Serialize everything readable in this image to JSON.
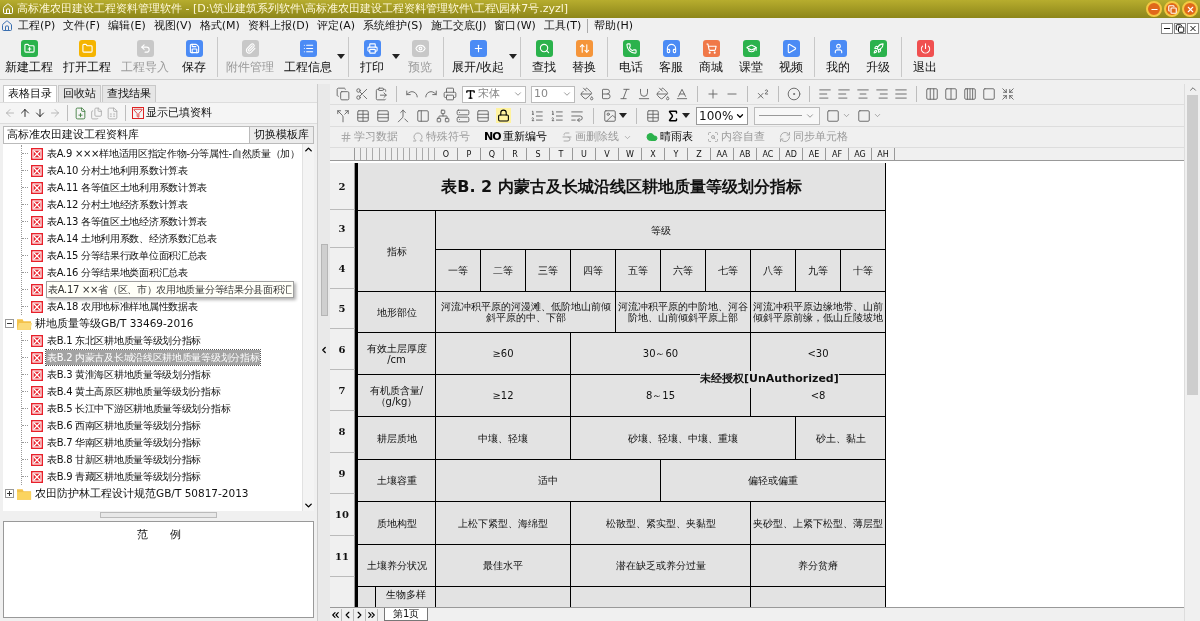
{
  "window": {
    "title": "高标准农田建设工程资料管理软件 - [D:\\筑业建筑系列软件\\高标准农田建设工程资料管理软件\\工程\\园林7号.zyzl]"
  },
  "menu": [
    "工程(P)",
    "文件(F)",
    "编辑(E)",
    "视图(V)",
    "格式(M)",
    "资料上报(D)",
    "评定(A)",
    "系统维护(S)",
    "施工交底(J)",
    "窗口(W)",
    "工具(T)",
    "帮助(H)"
  ],
  "toolbar": [
    [
      {
        "label": "新建工程",
        "disabled": false,
        "dropdown": false
      },
      {
        "label": "打开工程",
        "disabled": false,
        "dropdown": false
      },
      {
        "label": "工程导入",
        "disabled": true,
        "dropdown": false
      },
      {
        "label": "保存",
        "disabled": false,
        "dropdown": false
      }
    ],
    [
      {
        "label": "附件管理",
        "disabled": true,
        "dropdown": false
      },
      {
        "label": "工程信息",
        "disabled": false,
        "dropdown": true
      }
    ],
    [
      {
        "label": "打印",
        "disabled": false,
        "dropdown": true
      },
      {
        "label": "预览",
        "disabled": true,
        "dropdown": false
      }
    ],
    [
      {
        "label": "展开/收起",
        "disabled": false,
        "dropdown": true
      }
    ],
    [
      {
        "label": "查找",
        "disabled": false,
        "dropdown": false
      },
      {
        "label": "替换",
        "disabled": false,
        "dropdown": false
      }
    ],
    [
      {
        "label": "电话",
        "disabled": false,
        "dropdown": false
      },
      {
        "label": "客服",
        "disabled": false,
        "dropdown": false
      },
      {
        "label": "商城",
        "disabled": false,
        "dropdown": false
      },
      {
        "label": "课堂",
        "disabled": false,
        "dropdown": false
      },
      {
        "label": "视频",
        "disabled": false,
        "dropdown": false
      }
    ],
    [
      {
        "label": "我的",
        "disabled": false,
        "dropdown": false
      },
      {
        "label": "升级",
        "disabled": false,
        "dropdown": false
      }
    ],
    [
      {
        "label": "退出",
        "disabled": false,
        "dropdown": false
      }
    ]
  ],
  "left_panel": {
    "tabs": [
      {
        "label": "表格目录",
        "selected": true
      },
      {
        "label": "回收站",
        "selected": false
      },
      {
        "label": "查找结果",
        "selected": false
      }
    ],
    "filter_label": "显示已填资料",
    "library": {
      "value": "高标准农田建设工程资料库",
      "button": "切换模板库"
    },
    "tree": {
      "branch": [
        {
          "label": "表A.9 ×××样地适用区指定作物-分等属性-自然质量（加）",
          "selected": false,
          "hover": false
        },
        {
          "label": "表A.10 分村土地利用系数计算表",
          "selected": false,
          "hover": false
        },
        {
          "label": "表A.11 各等值区土地利用系数计算表",
          "selected": false,
          "hover": false
        },
        {
          "label": "表A.12 分村土地经济系数计算表",
          "selected": false,
          "hover": false
        },
        {
          "label": "表A.13 各等值区土地经济系数计算表",
          "selected": false,
          "hover": false
        },
        {
          "label": "表A.14 土地利用系数、经济系数汇总表",
          "selected": false,
          "hover": false
        },
        {
          "label": "表A.15 分等结果行政单位面积汇总表",
          "selected": false,
          "hover": false
        },
        {
          "label": "表A.16 分等结果地类面积汇总表",
          "selected": false,
          "hover": false
        },
        {
          "label": "表A.17 ××省（区、市）农用地质量分等结果分县面积汇",
          "selected": false,
          "hover": true
        },
        {
          "label": "表A.18 农用地标准样地属性数据表",
          "selected": false,
          "hover": false
        }
      ],
      "folders": [
        {
          "label": "耕地质量等级GB/T 33469-2016",
          "expanded": true,
          "children": [
            {
              "label": "表B.1 东北区耕地质量等级划分指标",
              "selected": false
            },
            {
              "label": "表B.2 内蒙古及长城沿线区耕地质量等级划分指标",
              "selected": true
            },
            {
              "label": "表B.3 黄淮海区耕地质量等级划分指标",
              "selected": false
            },
            {
              "label": "表B.4 黄土高原区耕地质量等级划分指标",
              "selected": false
            },
            {
              "label": "表B.5 长江中下游区耕地质量等级划分指标",
              "selected": false
            },
            {
              "label": "表B.6 西南区耕地质量等级划分指标",
              "selected": false
            },
            {
              "label": "表B.7 华南区耕地质量等级划分指标",
              "selected": false
            },
            {
              "label": "表B.8 甘新区耕地质量等级划分指标",
              "selected": false
            },
            {
              "label": "表B.9 青藏区耕地质量等级划分指标",
              "selected": false
            }
          ]
        },
        {
          "label": "农田防护林工程设计规范GB/T 50817-2013",
          "expanded": false
        }
      ]
    },
    "legend": {
      "title": "范　　例"
    }
  },
  "format_bar": {
    "font": {
      "value": "宋体",
      "disabled": true
    },
    "size": {
      "value": "10",
      "disabled": true
    },
    "zoom": {
      "value": "100%"
    },
    "tools": [
      {
        "label": "学习数据",
        "disabled": true,
        "dropdown": false
      },
      {
        "label": "特殊符号",
        "disabled": true,
        "dropdown": false
      },
      {
        "glyph": "NO",
        "label": "重新编号",
        "disabled": false,
        "dropdown": false
      },
      {
        "label": "画删除线",
        "disabled": true,
        "dropdown": true
      },
      {
        "label": "晴雨表",
        "disabled": false,
        "dropdown": false
      },
      {
        "label": "内容自查",
        "disabled": true,
        "dropdown": false
      },
      {
        "label": "同步单元格",
        "disabled": true,
        "dropdown": false
      }
    ]
  },
  "sheet": {
    "column_headers": [
      "O",
      "P",
      "Q",
      "R",
      "S",
      "T",
      "U",
      "V",
      "W",
      "X",
      "Y",
      "Z",
      "AA",
      "AB",
      "AC",
      "AD",
      "AE",
      "AF",
      "AG",
      "AH"
    ],
    "row_numbers": [
      "2",
      "3",
      "4",
      "5",
      "6",
      "7",
      "8",
      "9",
      "10",
      "11"
    ],
    "title": "表B. 2 内蒙古及长城沿线区耕地质量等级划分指标",
    "index_label": "指标",
    "grade_label": "等级",
    "grades": [
      "一等",
      "二等",
      "三等",
      "四等",
      "五等",
      "六等",
      "七等",
      "八等",
      "九等",
      "十等"
    ],
    "rows": [
      {
        "label": "地形部位",
        "cells": [
          "河流冲积平原的河漫滩、低阶地山前倾斜平原的中、下部",
          "河流冲积平原的中阶地、河谷阶地、山前倾斜平原上部",
          "河流冲积平原边缘地带、山前倾斜平原前缘，低山丘陵坡地"
        ]
      },
      {
        "label": "有效土层厚度\n/cm",
        "cells": [
          "≥60",
          "30～60",
          "<30"
        ]
      },
      {
        "label": "有机质含量/\n（g/kg）",
        "cells": [
          "≥12",
          "8～15",
          "<8"
        ]
      },
      {
        "label": "耕层质地",
        "cells": [
          "中壤、轻壤",
          "砂壤、轻壤、中壤、重壤",
          "砂土、黏土"
        ]
      },
      {
        "label": "土壤容重",
        "cells": [
          "适中",
          "偏轻或偏重"
        ]
      },
      {
        "label": "质地构型",
        "cells": [
          "上松下紧型、海绵型",
          "松散型、紧实型、夹黏型",
          "夹砂型、上紧下松型、薄层型"
        ]
      },
      {
        "label": "土壤养分状况",
        "cells": [
          "最佳水平",
          "潜在缺乏或养分过量",
          "养分贫瘠"
        ]
      },
      {
        "label": "生物多样",
        "cells": []
      }
    ],
    "overlay_notice": "未经授权[UnAuthorized]",
    "sheet_tabs": [
      {
        "label": "第1页",
        "selected": true
      }
    ]
  }
}
